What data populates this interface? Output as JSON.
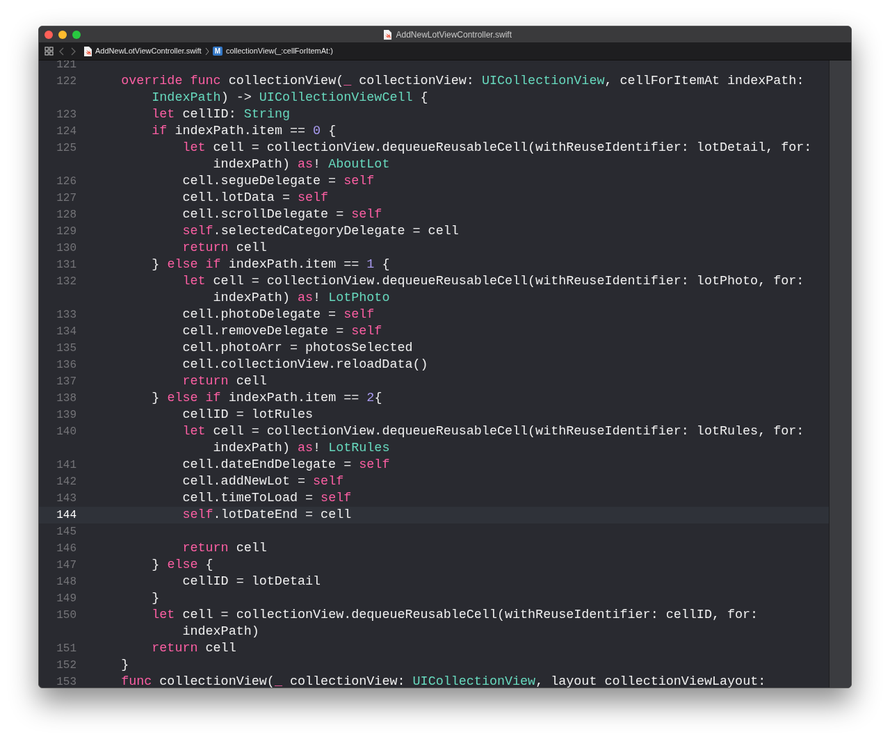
{
  "window": {
    "title": "AddNewLotViewController.swift"
  },
  "breadcrumb": {
    "file": "AddNewLotViewController.swift",
    "method_badge": "M",
    "method": "collectionView(_:cellForItemAt:)"
  },
  "editor": {
    "lines": [
      {
        "number": "121",
        "current": false
      },
      {
        "number": "122",
        "current": false,
        "tokens": [
          {
            "kind": "keyword",
            "text": "    override func"
          },
          {
            "kind": "plain",
            "text": " collectionView("
          },
          {
            "kind": "keyword",
            "text": "_"
          },
          {
            "kind": "plain",
            "text": " collectionView: "
          },
          {
            "kind": "type",
            "text": "UICollectionView"
          },
          {
            "kind": "plain",
            "text": ", cellForItemAt indexPath:"
          }
        ],
        "continuation": {
          "tokens": [
            {
              "kind": "type",
              "text": "        IndexPath"
            },
            {
              "kind": "plain",
              "text": ") -> "
            },
            {
              "kind": "type",
              "text": "UICollectionViewCell"
            },
            {
              "kind": "plain",
              "text": " {"
            }
          ]
        }
      },
      {
        "number": "123",
        "current": false,
        "tokens": [
          {
            "kind": "keyword",
            "text": "        let"
          },
          {
            "kind": "plain",
            "text": " cellID: "
          },
          {
            "kind": "type",
            "text": "String"
          }
        ]
      },
      {
        "number": "124",
        "current": false,
        "tokens": [
          {
            "kind": "keyword",
            "text": "        if"
          },
          {
            "kind": "plain",
            "text": " indexPath.item == "
          },
          {
            "kind": "number",
            "text": "0"
          },
          {
            "kind": "plain",
            "text": " {"
          }
        ]
      },
      {
        "number": "125",
        "current": false,
        "tokens": [
          {
            "kind": "keyword",
            "text": "            let"
          },
          {
            "kind": "plain",
            "text": " cell = collectionView.dequeueReusableCell(withReuseIdentifier: lotDetail, for:"
          }
        ],
        "continuation": {
          "tokens": [
            {
              "kind": "plain",
              "text": "                indexPath) "
            },
            {
              "kind": "keyword",
              "text": "as"
            },
            {
              "kind": "plain",
              "text": "! "
            },
            {
              "kind": "type",
              "text": "AboutLot"
            }
          ]
        }
      },
      {
        "number": "126",
        "current": false,
        "tokens": [
          {
            "kind": "plain",
            "text": "            cell.segueDelegate = "
          },
          {
            "kind": "keyword",
            "text": "self"
          }
        ]
      },
      {
        "number": "127",
        "current": false,
        "tokens": [
          {
            "kind": "plain",
            "text": "            cell.lotData = "
          },
          {
            "kind": "keyword",
            "text": "self"
          }
        ]
      },
      {
        "number": "128",
        "current": false,
        "tokens": [
          {
            "kind": "plain",
            "text": "            cell.scrollDelegate = "
          },
          {
            "kind": "keyword",
            "text": "self"
          }
        ]
      },
      {
        "number": "129",
        "current": false,
        "tokens": [
          {
            "kind": "keyword",
            "text": "            self"
          },
          {
            "kind": "plain",
            "text": ".selectedCategoryDelegate = cell"
          }
        ]
      },
      {
        "number": "130",
        "current": false,
        "tokens": [
          {
            "kind": "keyword",
            "text": "            return"
          },
          {
            "kind": "plain",
            "text": " cell"
          }
        ]
      },
      {
        "number": "131",
        "current": false,
        "tokens": [
          {
            "kind": "plain",
            "text": "        } "
          },
          {
            "kind": "keyword",
            "text": "else if"
          },
          {
            "kind": "plain",
            "text": " indexPath.item == "
          },
          {
            "kind": "number",
            "text": "1"
          },
          {
            "kind": "plain",
            "text": " {"
          }
        ]
      },
      {
        "number": "132",
        "current": false,
        "tokens": [
          {
            "kind": "keyword",
            "text": "            let"
          },
          {
            "kind": "plain",
            "text": " cell = collectionView.dequeueReusableCell(withReuseIdentifier: lotPhoto, for:"
          }
        ],
        "continuation": {
          "tokens": [
            {
              "kind": "plain",
              "text": "                indexPath) "
            },
            {
              "kind": "keyword",
              "text": "as"
            },
            {
              "kind": "plain",
              "text": "! "
            },
            {
              "kind": "type",
              "text": "LotPhoto"
            }
          ]
        }
      },
      {
        "number": "133",
        "current": false,
        "tokens": [
          {
            "kind": "plain",
            "text": "            cell.photoDelegate = "
          },
          {
            "kind": "keyword",
            "text": "self"
          }
        ]
      },
      {
        "number": "134",
        "current": false,
        "tokens": [
          {
            "kind": "plain",
            "text": "            cell.removeDelegate = "
          },
          {
            "kind": "keyword",
            "text": "self"
          }
        ]
      },
      {
        "number": "135",
        "current": false,
        "tokens": [
          {
            "kind": "plain",
            "text": "            cell.photoArr = photosSelected"
          }
        ]
      },
      {
        "number": "136",
        "current": false,
        "tokens": [
          {
            "kind": "plain",
            "text": "            cell.collectionView.reloadData()"
          }
        ]
      },
      {
        "number": "137",
        "current": false,
        "tokens": [
          {
            "kind": "keyword",
            "text": "            return"
          },
          {
            "kind": "plain",
            "text": " cell"
          }
        ]
      },
      {
        "number": "138",
        "current": false,
        "tokens": [
          {
            "kind": "plain",
            "text": "        } "
          },
          {
            "kind": "keyword",
            "text": "else if"
          },
          {
            "kind": "plain",
            "text": " indexPath.item == "
          },
          {
            "kind": "number",
            "text": "2"
          },
          {
            "kind": "plain",
            "text": "{"
          }
        ]
      },
      {
        "number": "139",
        "current": false,
        "tokens": [
          {
            "kind": "plain",
            "text": "            cellID = lotRules"
          }
        ]
      },
      {
        "number": "140",
        "current": false,
        "tokens": [
          {
            "kind": "keyword",
            "text": "            let"
          },
          {
            "kind": "plain",
            "text": " cell = collectionView.dequeueReusableCell(withReuseIdentifier: lotRules, for:"
          }
        ],
        "continuation": {
          "tokens": [
            {
              "kind": "plain",
              "text": "                indexPath) "
            },
            {
              "kind": "keyword",
              "text": "as"
            },
            {
              "kind": "plain",
              "text": "! "
            },
            {
              "kind": "type",
              "text": "LotRules"
            }
          ]
        }
      },
      {
        "number": "141",
        "current": false,
        "tokens": [
          {
            "kind": "plain",
            "text": "            cell.dateEndDelegate = "
          },
          {
            "kind": "keyword",
            "text": "self"
          }
        ]
      },
      {
        "number": "142",
        "current": false,
        "tokens": [
          {
            "kind": "plain",
            "text": "            cell.addNewLot = "
          },
          {
            "kind": "keyword",
            "text": "self"
          }
        ]
      },
      {
        "number": "143",
        "current": false,
        "tokens": [
          {
            "kind": "plain",
            "text": "            cell.timeToLoad = "
          },
          {
            "kind": "keyword",
            "text": "self"
          }
        ]
      },
      {
        "number": "144",
        "current": true,
        "tokens": [
          {
            "kind": "keyword",
            "text": "            self"
          },
          {
            "kind": "plain",
            "text": ".lotDateEnd = cell"
          }
        ]
      },
      {
        "number": "145",
        "current": false
      },
      {
        "number": "146",
        "current": false,
        "tokens": [
          {
            "kind": "keyword",
            "text": "            return"
          },
          {
            "kind": "plain",
            "text": " cell"
          }
        ]
      },
      {
        "number": "147",
        "current": false,
        "tokens": [
          {
            "kind": "plain",
            "text": "        } "
          },
          {
            "kind": "keyword",
            "text": "else"
          },
          {
            "kind": "plain",
            "text": " {"
          }
        ]
      },
      {
        "number": "148",
        "current": false,
        "tokens": [
          {
            "kind": "plain",
            "text": "            cellID = lotDetail"
          }
        ]
      },
      {
        "number": "149",
        "current": false,
        "tokens": [
          {
            "kind": "plain",
            "text": "        }"
          }
        ]
      },
      {
        "number": "150",
        "current": false,
        "tokens": [
          {
            "kind": "keyword",
            "text": "        let"
          },
          {
            "kind": "plain",
            "text": " cell = collectionView.dequeueReusableCell(withReuseIdentifier: cellID, for:"
          }
        ],
        "continuation": {
          "tokens": [
            {
              "kind": "plain",
              "text": "            indexPath)"
            }
          ]
        }
      },
      {
        "number": "151",
        "current": false,
        "tokens": [
          {
            "kind": "keyword",
            "text": "        return"
          },
          {
            "kind": "plain",
            "text": " cell"
          }
        ]
      },
      {
        "number": "152",
        "current": false,
        "tokens": [
          {
            "kind": "plain",
            "text": "    }"
          }
        ]
      },
      {
        "number": "153",
        "current": false,
        "tokens": [
          {
            "kind": "keyword",
            "text": "    func"
          },
          {
            "kind": "plain",
            "text": " collectionView("
          },
          {
            "kind": "keyword",
            "text": "_"
          },
          {
            "kind": "plain",
            "text": " collectionView: "
          },
          {
            "kind": "type",
            "text": "UICollectionView"
          },
          {
            "kind": "plain",
            "text": ", layout collectionViewLayout:"
          }
        ]
      }
    ]
  }
}
